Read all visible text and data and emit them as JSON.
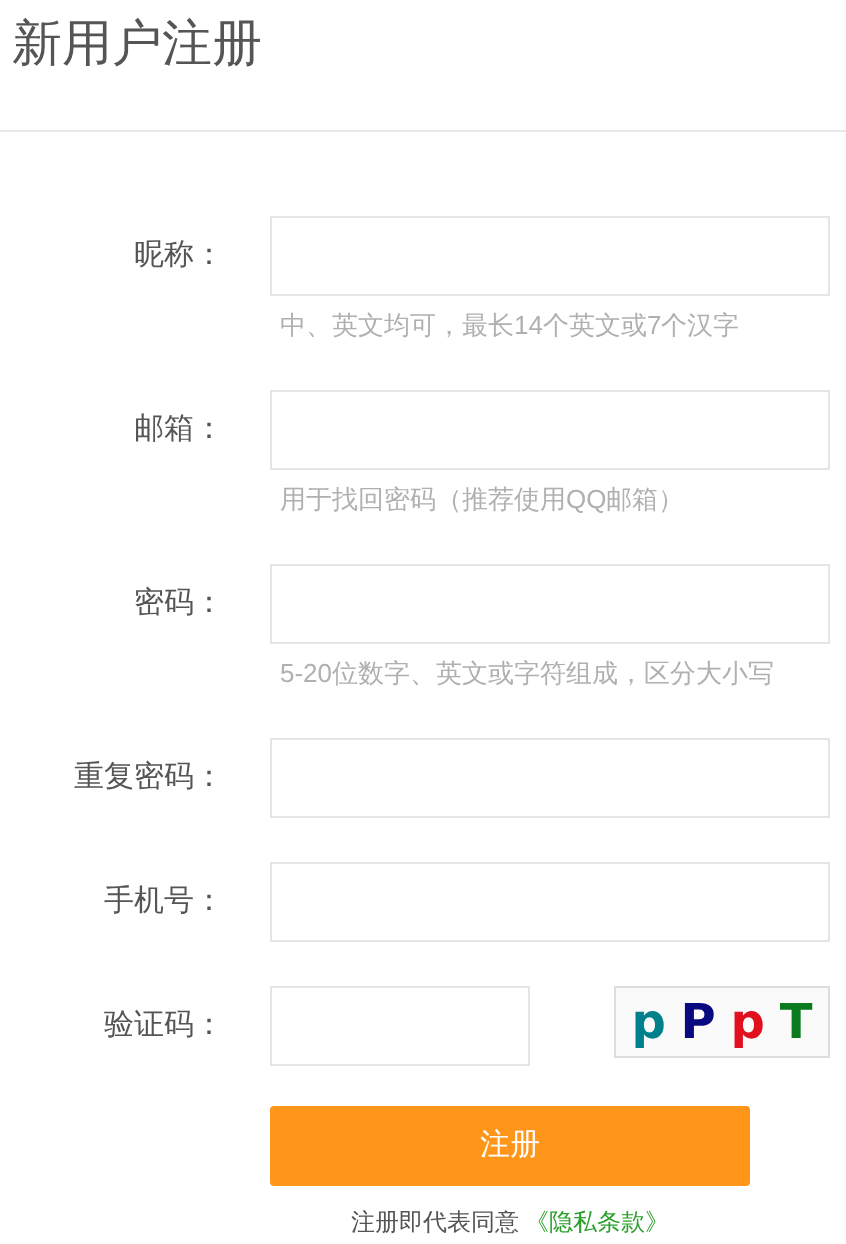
{
  "title": "新用户注册",
  "fields": [
    {
      "kind": "text",
      "label": "昵称：",
      "hint": "中、英文均可，最长14个英文或7个汉字"
    },
    {
      "kind": "text",
      "label": "邮箱：",
      "hint": "用于找回密码（推荐使用QQ邮箱）"
    },
    {
      "kind": "text",
      "label": "密码：",
      "hint": "5-20位数字、英文或字符组成，区分大小写"
    },
    {
      "kind": "text",
      "label": "重复密码："
    },
    {
      "kind": "text",
      "label": "手机号："
    },
    {
      "kind": "captcha",
      "label": "验证码：",
      "captcha": [
        {
          "char": "p",
          "color": "#00808a"
        },
        {
          "char": "P",
          "color": "#0a0a80"
        },
        {
          "char": "p",
          "color": "#e0101e"
        },
        {
          "char": "T",
          "color": "#0a7a1e"
        }
      ]
    }
  ],
  "submit": "注册",
  "agreement": {
    "text": "注册即代表同意",
    "link": "《隐私条款》"
  }
}
